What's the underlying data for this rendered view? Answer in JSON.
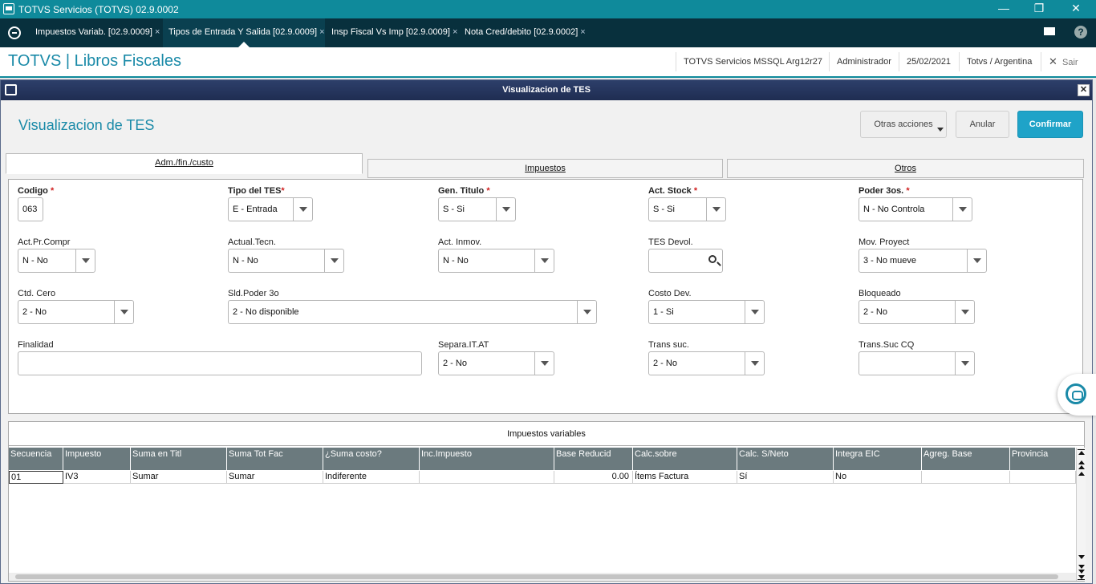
{
  "window": {
    "title": "TOTVS Servicios (TOTVS) 02.9.0002"
  },
  "tabs": [
    {
      "label": "Impuestos Variab. [02.9.0009]"
    },
    {
      "label": "Tipos de Entrada Y Salida [02.9.0009]"
    },
    {
      "label": "Insp Fiscal Vs Imp [02.9.0009]"
    },
    {
      "label": "Nota Cred/debito [02.9.0002]"
    }
  ],
  "header": {
    "app_title": "TOTVS | Libros Fiscales",
    "server": "TOTVS Servicios MSSQL Arg12r27",
    "user": "Administrador",
    "date": "25/02/2021",
    "company": "Totvs / Argentina",
    "exit_label": "Sair"
  },
  "dialog": {
    "title": "Visualizacion de TES",
    "page_title": "Visualizacion de TES",
    "buttons": {
      "more": "Otras acciones",
      "cancel": "Anular",
      "confirm": "Confirmar"
    },
    "form_tabs": [
      "Adm./fin./custo",
      "Impuestos",
      "Otros"
    ]
  },
  "form": {
    "codigo": {
      "label": "Codigo",
      "value": "063"
    },
    "tipo_tes": {
      "label": "Tipo del TES",
      "value": "E - Entrada"
    },
    "gen_titulo": {
      "label": "Gen. Titulo",
      "value": "S - Si"
    },
    "act_stock": {
      "label": "Act. Stock",
      "value": "S - Si"
    },
    "poder_3os": {
      "label": "Poder 3os.",
      "value": "N - No Controla"
    },
    "act_pr_compr": {
      "label": "Act.Pr.Compr",
      "value": "N - No"
    },
    "actual_tecn": {
      "label": "Actual.Tecn.",
      "value": "N - No"
    },
    "act_inmov": {
      "label": "Act. Inmov.",
      "value": "N - No"
    },
    "tes_devol": {
      "label": "TES Devol.",
      "value": ""
    },
    "mov_proyect": {
      "label": "Mov. Proyect",
      "value": "3 - No mueve"
    },
    "ctd_cero": {
      "label": "Ctd. Cero",
      "value": "2 - No"
    },
    "sld_poder_3o": {
      "label": "Sld.Poder 3o",
      "value": "2 - No disponible"
    },
    "costo_dev": {
      "label": "Costo Dev.",
      "value": "1 - Si"
    },
    "bloqueado": {
      "label": "Bloqueado",
      "value": "2 - No"
    },
    "finalidad": {
      "label": "Finalidad",
      "value": ""
    },
    "separa_it_at": {
      "label": "Separa.IT.AT",
      "value": "2 - No"
    },
    "trans_suc": {
      "label": "Trans suc.",
      "value": "2 - No"
    },
    "trans_suc_cq": {
      "label": "Trans.Suc CQ",
      "value": ""
    }
  },
  "grid": {
    "caption": "Impuestos variables",
    "columns": [
      "Secuencia",
      "Impuesto",
      "Suma en Titl",
      "Suma Tot Fac",
      "¿Suma costo?",
      "Inc.Impuesto",
      "Base Reducid",
      "Calc.sobre",
      "Calc. S/Neto",
      "Integra EIC",
      "Agreg. Base",
      "Provincia"
    ],
    "rows": [
      [
        "01",
        "IV3",
        "Sumar",
        "Sumar",
        "Indiferente",
        "",
        "0.00",
        "Ítems Factura",
        "Sí",
        "No",
        "",
        ""
      ]
    ]
  },
  "colors": {
    "accent": "#0f8a9b",
    "tabbar": "#08303d",
    "primary_button": "#1fa3c8",
    "required": "#d02020"
  }
}
